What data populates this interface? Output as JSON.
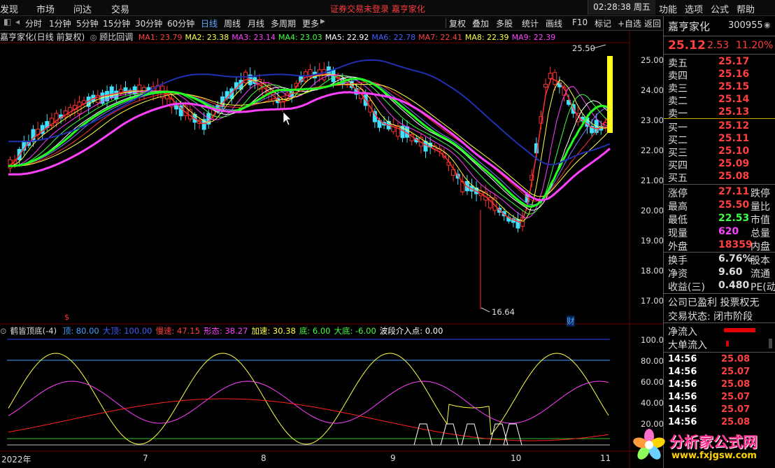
{
  "menubar": {
    "items": [
      "发现",
      "市场",
      "问达",
      "交易"
    ],
    "notice": "证券交易未登录   嘉亨家化",
    "clock": "02:28:38 周五",
    "right_items": [
      "功能",
      "选项",
      "公式",
      "帮助"
    ]
  },
  "toolbar": {
    "periods": [
      "分时",
      "1分钟",
      "5分钟",
      "15分钟",
      "30分钟",
      "60分钟",
      "日线",
      "周线",
      "月线",
      "多周期",
      "更多"
    ],
    "active": "日线",
    "actions": [
      "复权",
      "叠加",
      "多股",
      "统计",
      "画线",
      "F10",
      "标记",
      "+自选",
      "返回"
    ]
  },
  "chart_header": {
    "title": "嘉亨家化(日线 前复权)",
    "mode": "顾比回调",
    "ma": [
      {
        "label": "MA1: 23.79",
        "color": "#ff4040"
      },
      {
        "label": "MA2: 23.38",
        "color": "#ffff40"
      },
      {
        "label": "MA3: 23.14",
        "color": "#ff40ff"
      },
      {
        "label": "MA4: 23.03",
        "color": "#40ff40"
      },
      {
        "label": "MA5: 22.92",
        "color": "#ffffff"
      },
      {
        "label": "MA6: 22.78",
        "color": "#4060ff"
      },
      {
        "label": "MA7: 22.41",
        "color": "#ff4040"
      },
      {
        "label": "MA8: 22.39",
        "color": "#ffff40"
      },
      {
        "label": "MA9: 22.39",
        "color": "#ff40ff"
      }
    ]
  },
  "price_axis": [
    "25.00",
    "24.00",
    "23.00",
    "22.00",
    "21.00",
    "20.00",
    "19.00",
    "18.00",
    "17.00"
  ],
  "annotations": {
    "high": "25.50",
    "low": "16.64",
    "marker": "财",
    "dollar": "$"
  },
  "indicator": {
    "name": "鹤皆顶底(-4)",
    "params": [
      {
        "label": "顶: 80.00",
        "color": "#40a0ff"
      },
      {
        "label": "大顶: 100.00",
        "color": "#4060ff"
      },
      {
        "label": "慢速: 47.15",
        "color": "#ff4040"
      },
      {
        "label": "形态: 38.27",
        "color": "#ff40ff"
      },
      {
        "label": "加速: 30.38",
        "color": "#ffff40"
      },
      {
        "label": "底: 6.00",
        "color": "#40ff40"
      },
      {
        "label": "大底: -6.00",
        "color": "#40ff40"
      },
      {
        "label": "波段介入点: 0.00",
        "color": "#ffffff"
      }
    ],
    "axis": [
      "100.0",
      "80.00",
      "60.00",
      "40.00",
      "20.00"
    ]
  },
  "x_axis": [
    "2022年",
    "7",
    "8",
    "9",
    "10",
    "11"
  ],
  "quote": {
    "name": "嘉亨家化",
    "code": "300955",
    "price": "25.12",
    "change": "2.53",
    "pct": "11.20%",
    "asks": [
      {
        "label": "卖五",
        "price": "25.17"
      },
      {
        "label": "卖四",
        "price": "25.16"
      },
      {
        "label": "卖三",
        "price": "25.15"
      },
      {
        "label": "卖二",
        "price": "25.14"
      },
      {
        "label": "卖一",
        "price": "25.13"
      }
    ],
    "bids": [
      {
        "label": "买一",
        "price": "25.12"
      },
      {
        "label": "买二",
        "price": "25.11"
      },
      {
        "label": "买三",
        "price": "25.10"
      },
      {
        "label": "买四",
        "price": "25.09"
      },
      {
        "label": "买五",
        "price": "25.08"
      }
    ],
    "stats": [
      {
        "label": "涨停",
        "value": "27.11",
        "color": "#ff4040",
        "right": "跌停"
      },
      {
        "label": "最高",
        "value": "25.50",
        "color": "#ff4040",
        "right": "量比"
      },
      {
        "label": "最低",
        "value": "22.53",
        "color": "#40ff40",
        "right": "市值"
      },
      {
        "label": "现量",
        "value": "620",
        "color": "#ff40ff",
        "right": "总量"
      },
      {
        "label": "外盘",
        "value": "18359",
        "color": "#ff4040",
        "right": "内盘"
      }
    ],
    "stats2": [
      {
        "label": "换手",
        "value": "6.76%",
        "right": "股本"
      },
      {
        "label": "净资",
        "value": "9.60",
        "right": "流通"
      },
      {
        "label": "收益(三)",
        "value": "0.480",
        "right": "PE(动"
      }
    ],
    "status1": "公司已盈利 投票权无",
    "status2": "交易状态: 闭市阶段",
    "flow": [
      {
        "label": "净流入"
      },
      {
        "label": "大单流入"
      }
    ],
    "ticks": [
      {
        "time": "14:56",
        "price": "25.08"
      },
      {
        "time": "14:56",
        "price": "25.07"
      },
      {
        "time": "14:56",
        "price": "25.08"
      },
      {
        "time": "14:56",
        "price": "25.07"
      },
      {
        "time": "14:56",
        "price": "25.07"
      },
      {
        "time": "14:56",
        "price": "25.08"
      }
    ]
  },
  "logo": {
    "text": "分析家公式网",
    "url_text": "www.fxjgsw.com"
  }
}
